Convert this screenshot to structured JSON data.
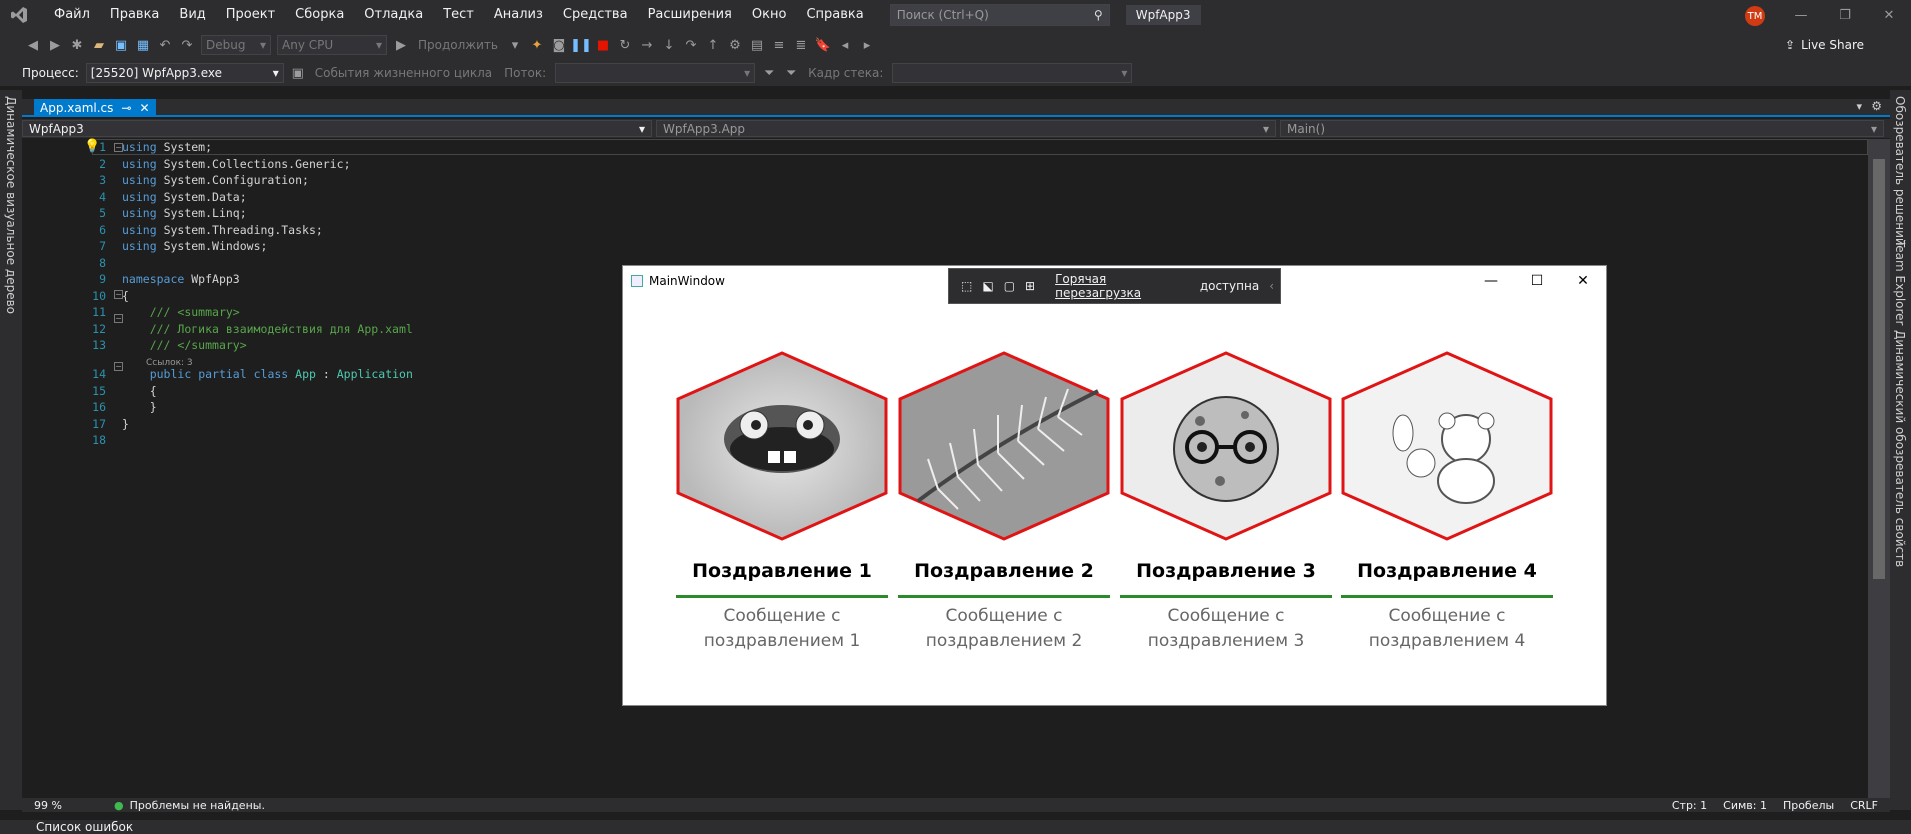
{
  "menu": [
    "Файл",
    "Правка",
    "Вид",
    "Проект",
    "Сборка",
    "Отладка",
    "Тест",
    "Анализ",
    "Средства",
    "Расширения",
    "Окно",
    "Справка"
  ],
  "search_placeholder": "Поиск (Ctrl+Q)",
  "project_name": "WpfApp3",
  "user_initials": "TM",
  "toolbar": {
    "config": "Debug",
    "platform": "Any CPU",
    "continue_label": "Продолжить",
    "live_share": "Live Share"
  },
  "toolbar2": {
    "process_label": "Процесс:",
    "process_value": "[25520] WpfApp3.exe",
    "lifecycle": "События жизненного цикла",
    "thread_label": "Поток:",
    "stackframe_label": "Кадр стека:"
  },
  "left_tab": "Динамическое визуальное дерево",
  "right_tabs": [
    "Обозреватель решений",
    "Team Explorer",
    "Динамический обозреватель свойств"
  ],
  "editor_tab": "App.xaml.cs",
  "nav": {
    "project": "WpfApp3",
    "class": "WpfApp3.App",
    "member": "Main()"
  },
  "code": {
    "l1": "System;",
    "l2": "System.Collections.Generic;",
    "l3": "System.Configuration;",
    "l4": "System.Data;",
    "l5": "System.Linq;",
    "l6": "System.Threading.Tasks;",
    "l7": "System.Windows;",
    "using": "using",
    "namespace_kw": "namespace",
    "ns": "WpfApp3",
    "c1": "/// <summary>",
    "c2": "/// Логика взаимодействия для App.xaml",
    "c3": "/// </summary>",
    "refs": "Ссылок: 3",
    "public": "public",
    "partial": "partial",
    "class": "class",
    "app": "App",
    ":": ":",
    "application": "Application",
    "ob": "{",
    "cb": "}"
  },
  "line_numbers": [
    "1",
    "2",
    "3",
    "4",
    "5",
    "6",
    "7",
    "8",
    "9",
    "10",
    "11",
    "12",
    "13",
    "14",
    "15",
    "16",
    "17",
    "18"
  ],
  "status": {
    "zoom": "99 %",
    "problems": "Проблемы не найдены.",
    "line": "Стр: 1",
    "col": "Симв: 1",
    "spaces": "Пробелы",
    "eol": "CRLF"
  },
  "error_list": "Список ошибок",
  "wpf": {
    "title": "MainWindow",
    "hotreload_link": "Горячая перезагрузка",
    "hotreload_rest": "доступна"
  },
  "cards": [
    {
      "title": "Поздравление 1",
      "msg1": "Сообщение с",
      "msg2": "поздравлением 1"
    },
    {
      "title": "Поздравление 2",
      "msg1": "Сообщение с",
      "msg2": "поздравлением 2"
    },
    {
      "title": "Поздравление 3",
      "msg1": "Сообщение с",
      "msg2": "поздравлением 3"
    },
    {
      "title": "Поздравление 4",
      "msg1": "Сообщение с",
      "msg2": "поздравлением 4"
    }
  ],
  "colors": {
    "accent": "#007acc",
    "hex_border": "#e01414",
    "underline": "#2b8a2b"
  }
}
